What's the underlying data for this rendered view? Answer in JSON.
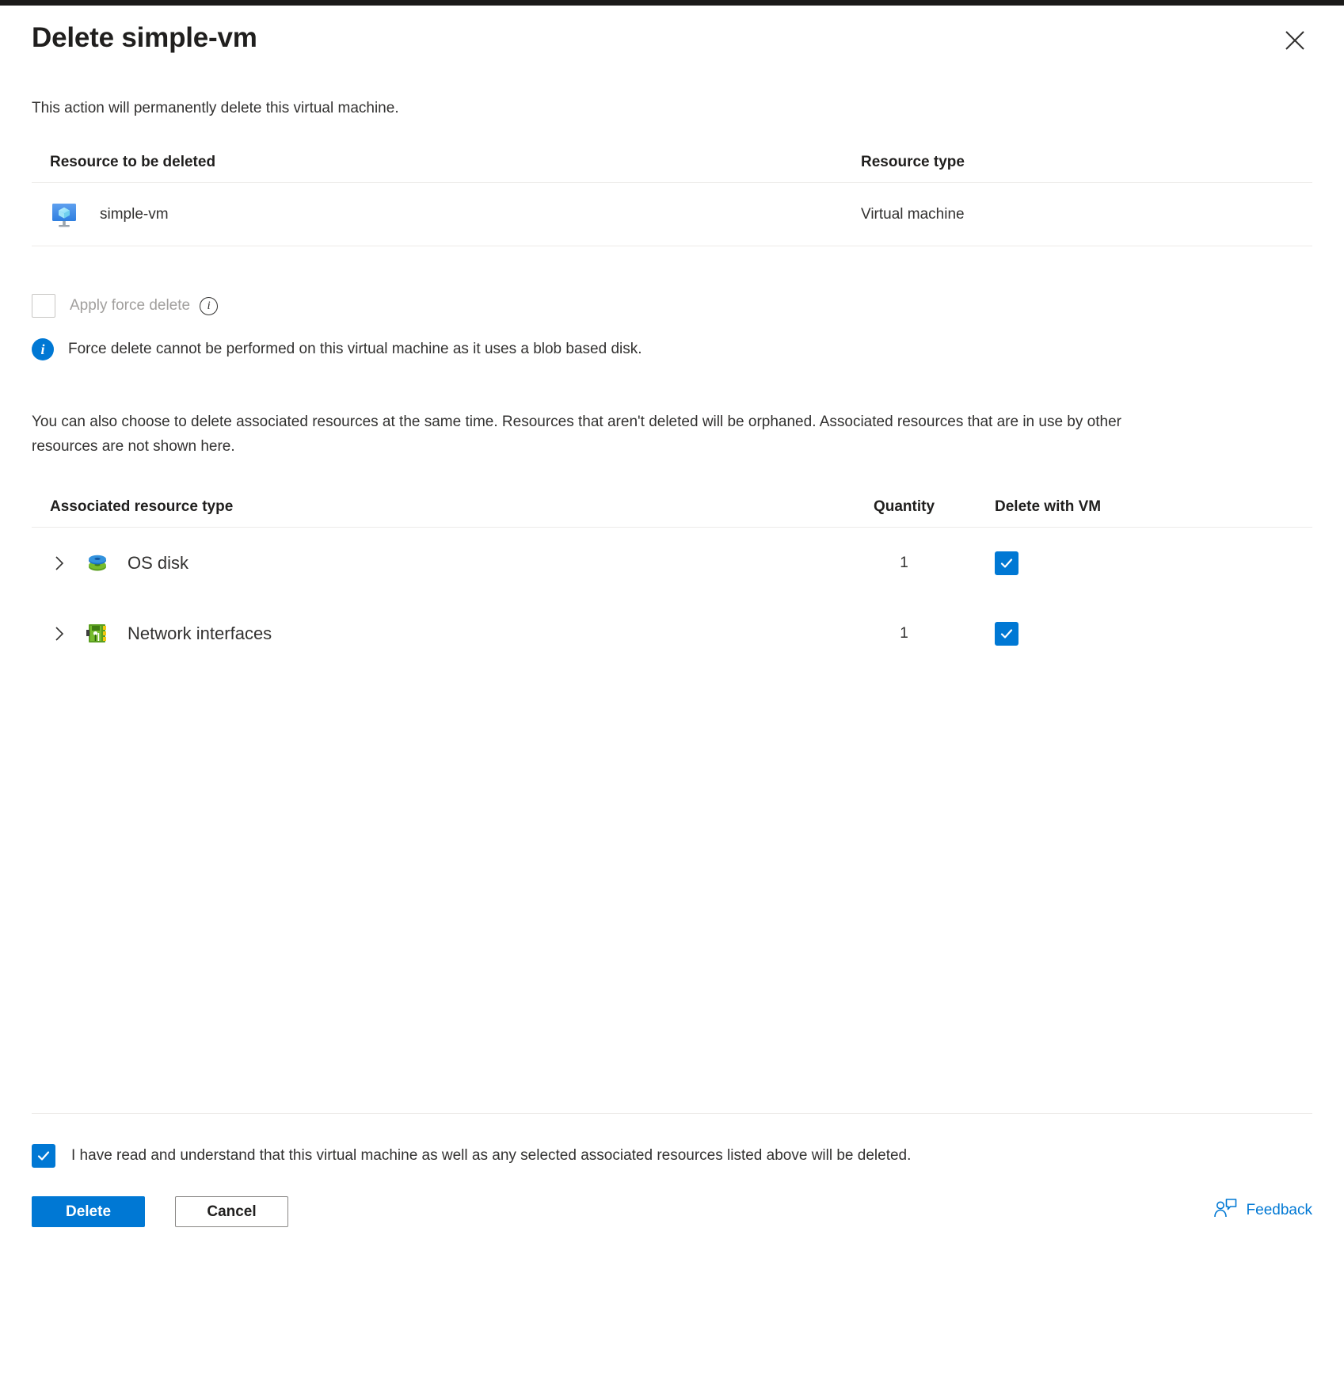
{
  "dialog": {
    "title": "Delete simple-vm",
    "close_icon": "close-icon",
    "intro": "This action will permanently delete this virtual machine."
  },
  "resource_table": {
    "headers": {
      "name": "Resource to be deleted",
      "type": "Resource type"
    },
    "rows": [
      {
        "icon": "virtual-machine-icon",
        "name": "simple-vm",
        "type": "Virtual machine"
      }
    ]
  },
  "force_delete": {
    "label": "Apply force delete",
    "info_icon": "info-outline-icon",
    "checked": false,
    "disabled": true,
    "message_icon": "info-filled-icon",
    "message": "Force delete cannot be performed on this virtual machine as it uses a blob based disk."
  },
  "paragraph": "You can also choose to delete associated resources at the same time. Resources that aren't deleted will be orphaned. Associated resources that are in use by other resources are not shown here.",
  "associated_table": {
    "headers": {
      "type": "Associated resource type",
      "quantity": "Quantity",
      "delete_with_vm": "Delete with VM"
    },
    "rows": [
      {
        "expand_icon": "chevron-right-icon",
        "icon": "os-disk-icon",
        "label": "OS disk",
        "quantity": "1",
        "checked": true
      },
      {
        "expand_icon": "chevron-right-icon",
        "icon": "network-interface-icon",
        "label": "Network interfaces",
        "quantity": "1",
        "checked": true
      }
    ]
  },
  "footer": {
    "acknowledgement": "I have read and understand that this virtual machine as well as any selected associated resources listed above will be deleted.",
    "acknowledgement_checked": true,
    "delete_label": "Delete",
    "cancel_label": "Cancel",
    "feedback_label": "Feedback",
    "feedback_icon": "feedback-person-icon"
  },
  "colors": {
    "accent": "#0078d4",
    "topbar": "#1b1a19",
    "text": "#323130",
    "muted": "#a19f9d",
    "border": "#edebe9"
  }
}
